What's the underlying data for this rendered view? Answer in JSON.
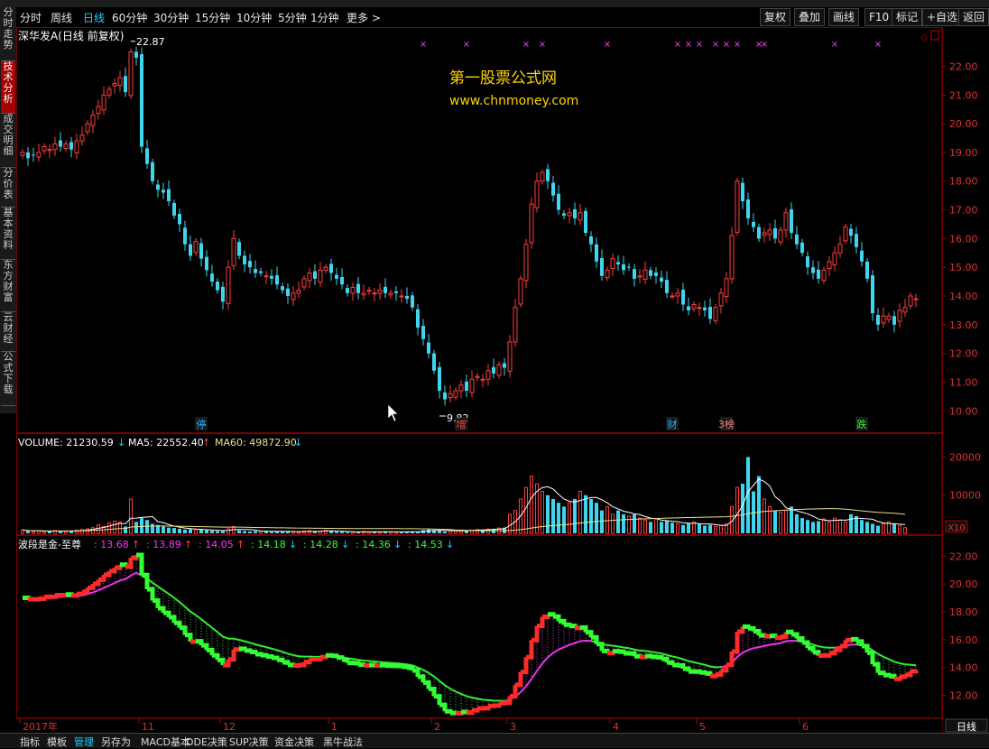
{
  "toolbar": {
    "periods": [
      "分时",
      "周线",
      "日线",
      "60分钟",
      "30分钟",
      "15分钟",
      "10分钟",
      "5分钟",
      "1分钟",
      "更多 >"
    ],
    "active_period": "日线",
    "right_buttons": [
      "复权",
      "叠加",
      "画线",
      "F10",
      "标记",
      "+自选",
      "返回"
    ]
  },
  "sidetabs": [
    "分时走势",
    "技术分析",
    "成交明细",
    "分价表",
    "基本资料",
    "东方财富",
    "云财经",
    "公式下载"
  ],
  "active_sidetab": "技术分析",
  "main": {
    "title": "深华发A(日线 前复权)",
    "high_label": "22.87",
    "low_label": "9.82",
    "watermark_title": "第一股票公式网",
    "watermark_url": "www.chnmoney.com",
    "markers": [
      {
        "text": "停",
        "color": "#33b5ff",
        "bar": 33
      },
      {
        "text": "增",
        "color": "#ff4040",
        "bar": 81
      },
      {
        "text": "财",
        "color": "#33b5ff",
        "bar": 120
      },
      {
        "text": "3榜",
        "color": "#ff8080",
        "bar": 130
      },
      {
        "text": "跌",
        "color": "#33ff33",
        "bar": 155
      }
    ],
    "x_marks_bars": [
      74,
      82,
      93,
      96,
      108,
      121,
      123,
      125,
      128,
      130,
      132,
      136,
      137,
      150,
      158
    ],
    "y_ticks": [
      "22.00",
      "21.00",
      "20.00",
      "19.00",
      "18.00",
      "17.00",
      "16.00",
      "15.00",
      "14.00",
      "13.00",
      "12.00",
      "11.00",
      "10.00"
    ]
  },
  "volume": {
    "label": "VOLUME: 21230.59",
    "ma5": "MA5: 22552.40",
    "ma60": "MA60: 49872.90",
    "y_ticks": [
      "20000",
      "10000"
    ],
    "unit": "X10"
  },
  "indicator": {
    "name": "波段是金-至尊",
    "values": [
      {
        "text": ": 13.68",
        "color": "#ff33ff",
        "arrow": "↑",
        "arrow_color": "#ff4040"
      },
      {
        "text": ": 13.89",
        "color": "#ff33ff",
        "arrow": "↑",
        "arrow_color": "#ff4040"
      },
      {
        "text": ": 14.05",
        "color": "#ff33ff",
        "arrow": "↑",
        "arrow_color": "#ff4040"
      },
      {
        "text": ": 14.18",
        "color": "#33ff33",
        "arrow": "↓",
        "arrow_color": "#19d3ff"
      },
      {
        "text": ": 14.28",
        "color": "#33ff33",
        "arrow": "↓",
        "arrow_color": "#19d3ff"
      },
      {
        "text": ": 14.36",
        "color": "#33ff33",
        "arrow": "↓",
        "arrow_color": "#19d3ff"
      },
      {
        "text": ": 14.53",
        "color": "#33ff33",
        "arrow": "↓",
        "arrow_color": "#19d3ff"
      }
    ],
    "y_ticks": [
      "22.00",
      "20.00",
      "18.00",
      "16.00",
      "14.00",
      "12.00"
    ]
  },
  "x_axis": [
    {
      "label": "2017年",
      "bar": 0
    },
    {
      "label": "11",
      "bar": 22
    },
    {
      "label": "12",
      "bar": 37
    },
    {
      "label": "1",
      "bar": 57
    },
    {
      "label": "2",
      "bar": 76
    },
    {
      "label": "3",
      "bar": 90
    },
    {
      "label": "4",
      "bar": 109
    },
    {
      "label": "5",
      "bar": 125
    },
    {
      "label": "6",
      "bar": 144
    }
  ],
  "period_indicator": "日线",
  "bottom_tabs": [
    "指标",
    "模板",
    "管理",
    "另存为",
    "MACD基本",
    "DDE决策",
    "SUP决策",
    "资金决策",
    "黑牛战法"
  ],
  "active_bottom_tab": "管理",
  "chart_data": {
    "type": "candlestick",
    "title": "深华发A(日线 前复权)",
    "ylim": [
      9.6,
      22.8
    ],
    "closes": [
      19.0,
      18.8,
      18.9,
      19.0,
      19.2,
      19.1,
      19.3,
      19.2,
      19.3,
      19.1,
      19.4,
      19.6,
      20.0,
      20.3,
      20.6,
      21.0,
      21.2,
      21.4,
      21.6,
      21.1,
      22.5,
      22.3,
      19.2,
      18.6,
      18.0,
      17.7,
      17.6,
      17.3,
      16.8,
      16.5,
      15.8,
      15.4,
      15.9,
      15.3,
      14.9,
      14.5,
      14.2,
      13.8,
      15.0,
      16.0,
      15.4,
      15.1,
      15.0,
      14.8,
      14.8,
      14.7,
      14.6,
      14.4,
      14.2,
      14.0,
      14.1,
      14.2,
      14.6,
      14.8,
      14.6,
      14.9,
      15.0,
      14.8,
      14.6,
      14.4,
      14.1,
      14.3,
      14.1,
      14.1,
      14.2,
      14.1,
      14.2,
      14.1,
      14.1,
      14.1,
      14.0,
      13.9,
      13.6,
      12.9,
      12.5,
      12.0,
      11.4,
      10.7,
      10.4,
      10.6,
      10.7,
      10.9,
      10.7,
      11.1,
      11.2,
      11.1,
      11.4,
      11.3,
      11.6,
      11.5,
      12.4,
      13.6,
      14.6,
      15.8,
      17.2,
      18.0,
      18.3,
      18.0,
      17.5,
      17.0,
      16.8,
      16.9,
      16.7,
      16.9,
      16.2,
      15.8,
      15.2,
      14.7,
      14.9,
      15.3,
      15.1,
      14.9,
      15.0,
      14.6,
      14.7,
      14.9,
      14.7,
      14.7,
      14.5,
      14.1,
      14.0,
      14.1,
      13.7,
      13.5,
      13.7,
      13.6,
      13.5,
      13.2,
      13.6,
      14.1,
      14.6,
      16.1,
      18.0,
      17.3,
      16.7,
      16.4,
      16.0,
      16.2,
      16.3,
      16.0,
      16.3,
      16.9,
      16.2,
      15.8,
      15.5,
      15.0,
      14.8,
      14.6,
      14.9,
      15.2,
      15.5,
      15.8,
      16.4,
      16.1,
      15.7,
      15.2,
      14.6,
      13.4,
      13.0,
      13.3,
      13.3,
      13.0,
      13.5,
      13.6,
      14.0,
      13.9
    ],
    "volumes": [
      900,
      600,
      500,
      700,
      400,
      600,
      700,
      600,
      500,
      700,
      800,
      1000,
      1200,
      1500,
      2200,
      1800,
      2800,
      3200,
      3000,
      1800,
      9000,
      3000,
      4000,
      3500,
      2500,
      2200,
      1800,
      1500,
      1400,
      1200,
      1000,
      1100,
      900,
      1000,
      800,
      700,
      600,
      600,
      1200,
      1800,
      800,
      600,
      500,
      600,
      500,
      600,
      400,
      500,
      500,
      500,
      400,
      300,
      600,
      700,
      500,
      600,
      800,
      600,
      400,
      400,
      300,
      400,
      300,
      500,
      400,
      400,
      300,
      500,
      400,
      300,
      400,
      400,
      500,
      400,
      800,
      1000,
      900,
      700,
      500,
      600,
      700,
      800,
      900,
      800,
      1000,
      900,
      1100,
      1200,
      1400,
      1500,
      5000,
      6000,
      9000,
      12000,
      15000,
      13000,
      11000,
      10000,
      9000,
      8000,
      7000,
      8000,
      9000,
      11000,
      10000,
      9000,
      8000,
      6000,
      7000,
      5000,
      6000,
      5000,
      4500,
      5000,
      4000,
      3500,
      3000,
      3800,
      3000,
      3200,
      2800,
      2500,
      2200,
      2600,
      3000,
      2400,
      2000,
      2200,
      1800,
      2100,
      2400,
      7000,
      12000,
      13000,
      20000,
      11000,
      15000,
      9000,
      7000,
      6000,
      5500,
      6000,
      7000,
      5000,
      4000,
      3500,
      3000,
      3200,
      3800,
      3000,
      4000,
      3500,
      3000,
      5000,
      4500,
      3500,
      3000,
      2500,
      2000,
      2500,
      3000,
      2500,
      2000,
      1500
    ],
    "volume_ylim": [
      0,
      22000
    ]
  }
}
